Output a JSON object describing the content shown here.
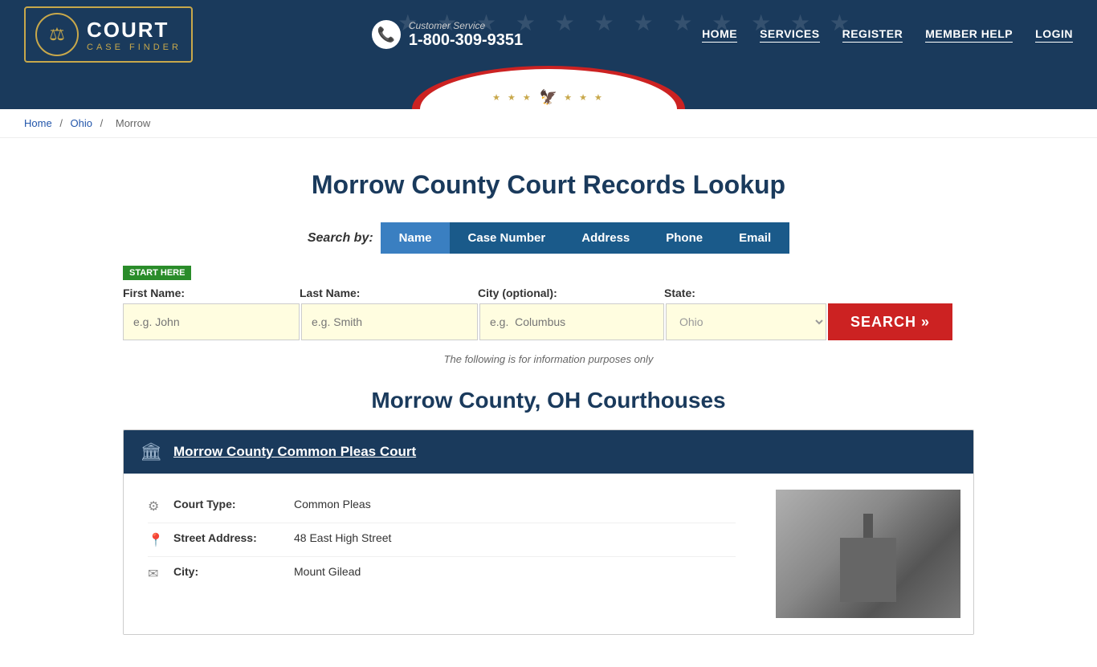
{
  "header": {
    "logo": {
      "court_label": "COURT",
      "sub_label": "CASE FINDER",
      "emblem_icon": "⚖"
    },
    "customer_service": {
      "label": "Customer Service",
      "phone": "1-800-309-9351",
      "phone_icon": "📞"
    },
    "nav": [
      {
        "label": "HOME",
        "href": "#"
      },
      {
        "label": "SERVICES",
        "href": "#"
      },
      {
        "label": "REGISTER",
        "href": "#"
      },
      {
        "label": "MEMBER HELP",
        "href": "#"
      },
      {
        "label": "LOGIN",
        "href": "#"
      }
    ]
  },
  "breadcrumb": {
    "items": [
      {
        "label": "Home",
        "href": "#"
      },
      {
        "label": "Ohio",
        "href": "#"
      },
      {
        "label": "Morrow",
        "href": "#"
      }
    ]
  },
  "main": {
    "page_title": "Morrow County Court Records Lookup",
    "search": {
      "by_label": "Search by:",
      "tabs": [
        {
          "label": "Name",
          "active": true
        },
        {
          "label": "Case Number",
          "active": false
        },
        {
          "label": "Address",
          "active": false
        },
        {
          "label": "Phone",
          "active": false
        },
        {
          "label": "Email",
          "active": false
        }
      ],
      "start_here": "START HERE",
      "fields": {
        "first_name_label": "First Name:",
        "first_name_placeholder": "e.g. John",
        "last_name_label": "Last Name:",
        "last_name_placeholder": "e.g. Smith",
        "city_label": "City (optional):",
        "city_placeholder": "e.g.  Columbus",
        "state_label": "State:",
        "state_value": "Ohio"
      },
      "search_btn": "SEARCH »",
      "info_note": "The following is for information purposes only"
    },
    "courthouses": {
      "section_title": "Morrow County, OH Courthouses",
      "cards": [
        {
          "name": "Morrow County Common Pleas Court",
          "header_icon": "🏛",
          "details": [
            {
              "icon": "⚙",
              "label": "Court Type:",
              "value": "Common Pleas"
            },
            {
              "icon": "📍",
              "label": "Street Address:",
              "value": "48 East High Street"
            },
            {
              "icon": "📧",
              "label": "City:",
              "value": "Mount Gilead"
            }
          ]
        }
      ]
    }
  }
}
